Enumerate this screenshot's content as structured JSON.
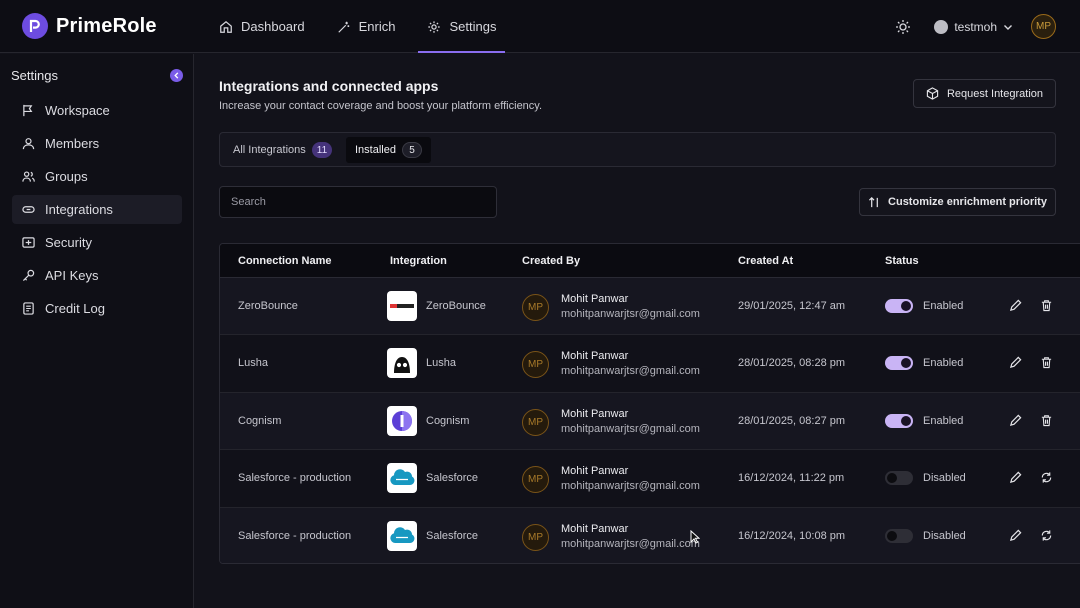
{
  "app": {
    "name": "PrimeRole"
  },
  "nav": [
    {
      "label": "Dashboard",
      "icon": "home-icon"
    },
    {
      "label": "Enrich",
      "icon": "magic-wand-icon"
    },
    {
      "label": "Settings",
      "icon": "gear-icon"
    }
  ],
  "user": {
    "username": "testmoh",
    "initials": "MP"
  },
  "sidebar": {
    "title": "Settings",
    "items": [
      {
        "label": "Workspace",
        "icon": "workspace-icon"
      },
      {
        "label": "Members",
        "icon": "user-icon"
      },
      {
        "label": "Groups",
        "icon": "users-icon"
      },
      {
        "label": "Integrations",
        "icon": "link-icon",
        "active": true
      },
      {
        "label": "Security",
        "icon": "shield-icon"
      },
      {
        "label": "API Keys",
        "icon": "key-icon"
      },
      {
        "label": "Credit Log",
        "icon": "document-icon"
      }
    ]
  },
  "main": {
    "title": "Integrations and connected apps",
    "subtitle": "Increase your contact coverage and boost your platform efficiency.",
    "request_button": "Request Integration",
    "tabs": [
      {
        "label": "All Integrations",
        "count": "11"
      },
      {
        "label": "Installed",
        "count": "5"
      }
    ],
    "search_placeholder": "Search",
    "customize_button": "Customize enrichment priority"
  },
  "table": {
    "headers": [
      "Connection Name",
      "Integration",
      "Created By",
      "Created At",
      "Status"
    ],
    "rows": [
      {
        "name": "ZeroBounce",
        "integration": "ZeroBounce",
        "by_name": "Mohit Panwar",
        "by_email": "mohitpanwarjtsr@gmail.com",
        "initials": "MP",
        "created": "29/01/2025, 12:47 am",
        "status": "Enabled"
      },
      {
        "name": "Lusha",
        "integration": "Lusha",
        "by_name": "Mohit Panwar",
        "by_email": "mohitpanwarjtsr@gmail.com",
        "initials": "MP",
        "created": "28/01/2025, 08:28 pm",
        "status": "Enabled"
      },
      {
        "name": "Cognism",
        "integration": "Cognism",
        "by_name": "Mohit Panwar",
        "by_email": "mohitpanwarjtsr@gmail.com",
        "initials": "MP",
        "created": "28/01/2025, 08:27 pm",
        "status": "Enabled"
      },
      {
        "name": "Salesforce - production",
        "integration": "Salesforce",
        "by_name": "Mohit Panwar",
        "by_email": "mohitpanwarjtsr@gmail.com",
        "initials": "MP",
        "created": "16/12/2024, 11:22 pm",
        "status": "Disabled"
      },
      {
        "name": "Salesforce - production",
        "integration": "Salesforce",
        "by_name": "Mohit Panwar",
        "by_email": "mohitpanwarjtsr@gmail.com",
        "initials": "MP",
        "created": "16/12/2024, 10:08 pm",
        "status": "Disabled"
      }
    ]
  },
  "colors": {
    "accent": "#7a5ce8",
    "toggle_on": "#c9b4f5"
  }
}
